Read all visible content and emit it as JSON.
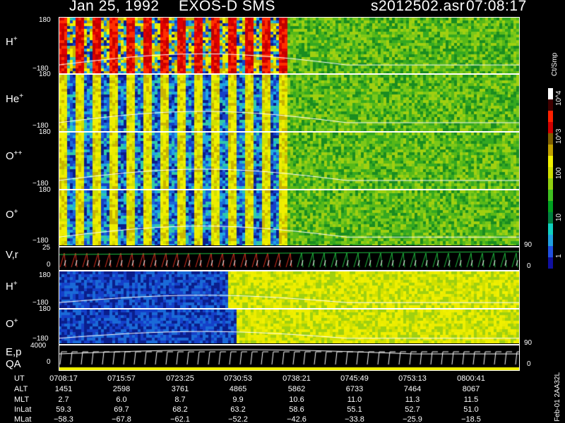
{
  "header": {
    "date": "Jan 25, 1992",
    "mission": "EXOS-D SMS",
    "file": "s2012502.asr",
    "time": "07:08:17"
  },
  "chart_data": {
    "type": "heatmap",
    "title": "Jan 25, 1992   EXOS-D SMS",
    "colorbar": {
      "label": "Ct/Smp",
      "scale": "log",
      "tick_labels": [
        "1",
        "10",
        "100",
        "10^3",
        "10^4"
      ],
      "colors": [
        "#1010a0",
        "#2050e0",
        "#20a0e0",
        "#10d0c0",
        "#008040",
        "#00a020",
        "#40c020",
        "#90d010",
        "#d0e000",
        "#f0f000",
        "#c0a000",
        "#806000",
        "#d00000",
        "#ff2000",
        "#400000",
        "#ffffff"
      ]
    },
    "panels": [
      {
        "label": "H",
        "charge": "+",
        "yticks": [
          "180",
          "−180"
        ]
      },
      {
        "label": "He",
        "charge": "+",
        "yticks": [
          "180",
          "−180"
        ]
      },
      {
        "label": "O",
        "charge": "++",
        "yticks": [
          "180",
          "−180"
        ]
      },
      {
        "label": "O",
        "charge": "+",
        "yticks": [
          "180",
          "−180"
        ],
        "right_tick": "90"
      },
      {
        "label": "V,r",
        "charge": "",
        "yticks": [
          "25",
          "0"
        ],
        "right_tick": "0"
      },
      {
        "label": "H",
        "charge": "+",
        "yticks": [
          "180",
          "−180"
        ]
      },
      {
        "label": "O",
        "charge": "+",
        "yticks": [
          "180",
          "−180"
        ],
        "right_tick": "90"
      },
      {
        "label": "E,p",
        "label2": "QA",
        "charge": "",
        "yticks": [
          "4000",
          "0"
        ],
        "right_tick": "0"
      }
    ],
    "x_axis": {
      "rows": [
        {
          "name": "UT",
          "values": [
            "0708:17",
            "0715:57",
            "0723:25",
            "0730:53",
            "0738:21",
            "0745:49",
            "0753:13",
            "0800:41"
          ]
        },
        {
          "name": "ALT",
          "values": [
            "1451",
            "2598",
            "3761",
            "4865",
            "5862",
            "6733",
            "7464",
            "8067"
          ]
        },
        {
          "name": "MLT",
          "values": [
            "2.7",
            "6.0",
            "8.7",
            "9.9",
            "10.6",
            "11.0",
            "11.3",
            "11.5"
          ]
        },
        {
          "name": "InLat",
          "values": [
            "59.3",
            "69.7",
            "68.2",
            "63.2",
            "58.6",
            "55.1",
            "52.7",
            "51.0"
          ]
        },
        {
          "name": "MLat",
          "values": [
            "−58.3",
            "−67.8",
            "−62.1",
            "−52.2",
            "−42.6",
            "−33.8",
            "−25.9",
            "−18.5"
          ]
        }
      ]
    },
    "footer": "Feb-01 2AA32L"
  }
}
